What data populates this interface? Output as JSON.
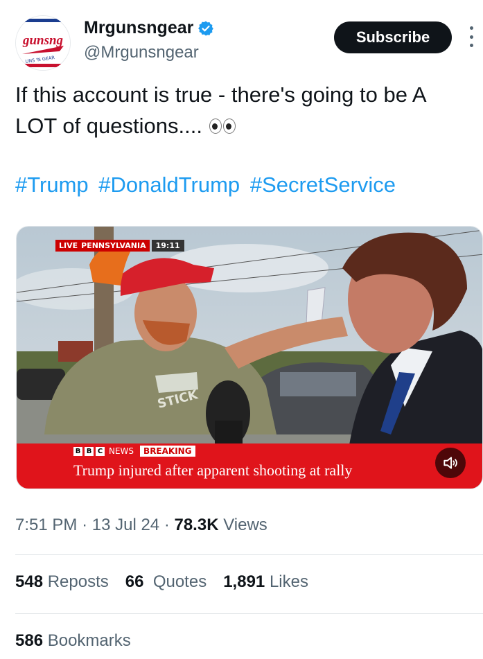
{
  "author": {
    "display_name": "Mrgunsngear",
    "handle": "@Mrgunsngear",
    "verified_icon": "verified-badge-icon",
    "avatar_text": "gunsng",
    "avatar_subtext": "UNS 'N GEAR"
  },
  "subscribe_label": "Subscribe",
  "tweet": {
    "line1": "If this account is true - there's going to be A",
    "line2": "LOT of questions....",
    "emoji": "eyes-emoji",
    "hashtags": [
      "#Trump",
      "#DonaldTrump",
      "#SecretService"
    ]
  },
  "media": {
    "live_label": "LIVE",
    "location": "PENNSYLVANIA",
    "time": "19:11",
    "bbc_letters": [
      "B",
      "B",
      "C"
    ],
    "news_label": "NEWS",
    "breaking_label": "BREAKING",
    "headline": "Trump injured after apparent shooting at rally",
    "shirt_text": "STICK",
    "mute_icon": "speaker-mute-icon"
  },
  "meta": {
    "time": "7:51 PM",
    "sep": "·",
    "date": "13 Jul 24",
    "views_count": "78.3K",
    "views_label": "Views"
  },
  "stats": {
    "reposts_count": "548",
    "reposts_label": "Reposts",
    "quotes_count": "66",
    "quotes_label": "Quotes",
    "likes_count": "1,891",
    "likes_label": "Likes",
    "bookmarks_count": "586",
    "bookmarks_label": "Bookmarks"
  },
  "colors": {
    "link": "#1d9bf0",
    "text": "#0f1419",
    "muted": "#536471",
    "bbc_red": "#e0141b"
  }
}
